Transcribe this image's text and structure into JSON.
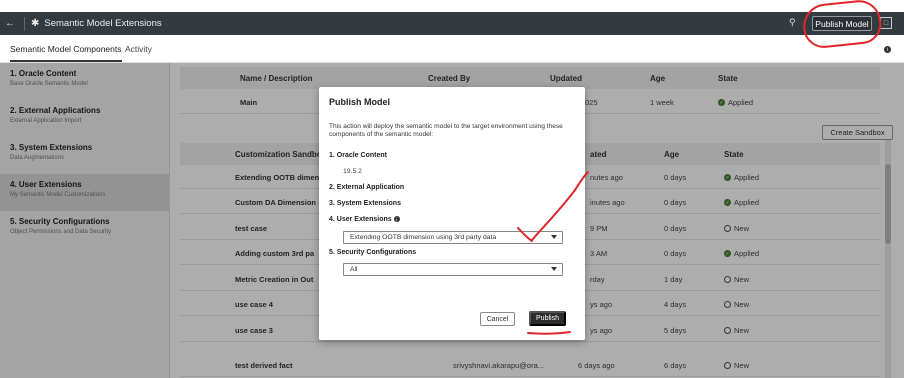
{
  "topbar": {
    "back_icon": "back-arrow-icon",
    "app_icon": "gear-icon",
    "title": "Semantic Model Extensions",
    "publish_label": "Publish Model",
    "bell_icon": "bell-icon",
    "profile_icon": "user-profile-icon"
  },
  "tabs": [
    {
      "label": "Semantic Model Components",
      "active": true
    },
    {
      "label": "Activity",
      "active": false
    }
  ],
  "sidebar": {
    "items": [
      {
        "title": "1. Oracle Content",
        "subtitle": "Base Oracle Semantic Model"
      },
      {
        "title": "2. External Applications",
        "subtitle": "External Application Import"
      },
      {
        "title": "3. System Extensions",
        "subtitle": "Data Augmentations"
      },
      {
        "title": "4. User Extensions",
        "subtitle": "My Semantic Model Customizations",
        "active": true
      },
      {
        "title": "5. Security Configurations",
        "subtitle": "Object Permissions and Data Security"
      }
    ]
  },
  "main_table": {
    "headers": [
      "Name / Description",
      "Created By",
      "Updated",
      "Age",
      "State"
    ],
    "row": {
      "name": "Main",
      "updated": "025",
      "age": "1 week",
      "state": "Applied"
    }
  },
  "create_sandbox_label": "Create Sandbox",
  "sandbox_table": {
    "headers": [
      "Customization Sandbo",
      "ated",
      "Age",
      "State"
    ],
    "rows": [
      {
        "name": "Extending OOTB dimen",
        "created_by": "",
        "updated": "nutes ago",
        "age": "0 days",
        "state": "Applied"
      },
      {
        "name": "Custom DA Dimension",
        "created_by": "",
        "updated": "inutes ago",
        "age": "0 days",
        "state": "Applied"
      },
      {
        "name": "test case",
        "created_by": "",
        "updated": "9 PM",
        "age": "0 days",
        "state": "New"
      },
      {
        "name": "Adding custom 3rd pa",
        "created_by": "",
        "updated": "3 AM",
        "age": "0 days",
        "state": "Applied"
      },
      {
        "name": "Metric Creation in Out",
        "created_by": "",
        "updated": "rday",
        "age": "1 day",
        "state": "New"
      },
      {
        "name": "use case 4",
        "created_by": "",
        "updated": "ys ago",
        "age": "4 days",
        "state": "New"
      },
      {
        "name": "use case 3",
        "created_by": "",
        "updated": "ys ago",
        "age": "5 days",
        "state": "New"
      },
      {
        "name": "test derived fact",
        "created_by": "srivyshnavi.akarapu@ora...",
        "updated": "6 days ago",
        "age": "6 days",
        "state": "New"
      }
    ]
  },
  "dialog": {
    "title": "Publish Model",
    "description": "This action will deploy the semantic model to the target environment using these components of the semantic model:",
    "item1_label": "1. Oracle Content",
    "item1_value": "19.5.2",
    "item2_label": "2. External Application",
    "item3_label": "3. System Extensions",
    "item4_label": "4. User Extensions",
    "item4_selected": "Extending OOTB dimension using 3rd party data",
    "item5_label": "5. Security Configurations",
    "item5_selected": "All",
    "cancel_label": "Cancel",
    "publish_label": "Publish"
  },
  "colors": {
    "topbar_bg": "#333b40",
    "applied_green": "#4a7c3a",
    "annotation_red": "#e0262a",
    "publish_btn_bg": "#2c2c2c"
  }
}
